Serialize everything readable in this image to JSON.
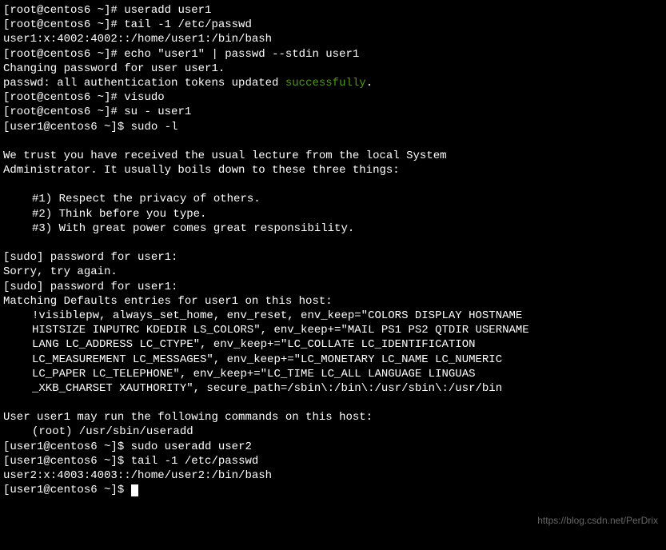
{
  "lines": {
    "l1_prompt": "[root@centos6 ~]# ",
    "l1_cmd": "useradd user1",
    "l2_prompt": "[root@centos6 ~]# ",
    "l2_cmd": "tail -1 /etc/passwd",
    "l3": "user1:x:4002:4002::/home/user1:/bin/bash",
    "l4_prompt": "[root@centos6 ~]# ",
    "l4_cmd": "echo \"user1\" | passwd --stdin user1",
    "l5": "Changing password for user user1.",
    "l6a": "passwd: all authentication tokens updated ",
    "l6b": "successfully",
    "l6c": ".",
    "l7_prompt": "[root@centos6 ~]# ",
    "l7_cmd": "visudo",
    "l8_prompt": "[root@centos6 ~]# ",
    "l8_cmd": "su - user1",
    "l9_prompt": "[user1@centos6 ~]$ ",
    "l9_cmd": "sudo -l",
    "l10": "We trust you have received the usual lecture from the local System",
    "l11": "Administrator. It usually boils down to these three things:",
    "l12": "#1) Respect the privacy of others.",
    "l13": "#2) Think before you type.",
    "l14": "#3) With great power comes great responsibility.",
    "l15": "[sudo] password for user1:",
    "l16": "Sorry, try again.",
    "l17": "[sudo] password for user1:",
    "l18": "Matching Defaults entries for user1 on this host:",
    "l19": "!visiblepw, always_set_home, env_reset, env_keep=\"COLORS DISPLAY HOSTNAME",
    "l20": "HISTSIZE INPUTRC KDEDIR LS_COLORS\", env_keep+=\"MAIL PS1 PS2 QTDIR USERNAME",
    "l21": "LANG LC_ADDRESS LC_CTYPE\", env_keep+=\"LC_COLLATE LC_IDENTIFICATION",
    "l22": "LC_MEASUREMENT LC_MESSAGES\", env_keep+=\"LC_MONETARY LC_NAME LC_NUMERIC",
    "l23": "LC_PAPER LC_TELEPHONE\", env_keep+=\"LC_TIME LC_ALL LANGUAGE LINGUAS",
    "l24": "_XKB_CHARSET XAUTHORITY\", secure_path=/sbin\\:/bin\\:/usr/sbin\\:/usr/bin",
    "l25": "User user1 may run the following commands on this host:",
    "l26": "(root) /usr/sbin/useradd",
    "l27_prompt": "[user1@centos6 ~]$ ",
    "l27_cmd": "sudo useradd user2",
    "l28_prompt": "[user1@centos6 ~]$ ",
    "l28_cmd": "tail -1 /etc/passwd",
    "l29": "user2:x:4003:4003::/home/user2:/bin/bash",
    "l30_prompt": "[user1@centos6 ~]$ "
  },
  "watermark": "https://blog.csdn.net/PerDrix"
}
